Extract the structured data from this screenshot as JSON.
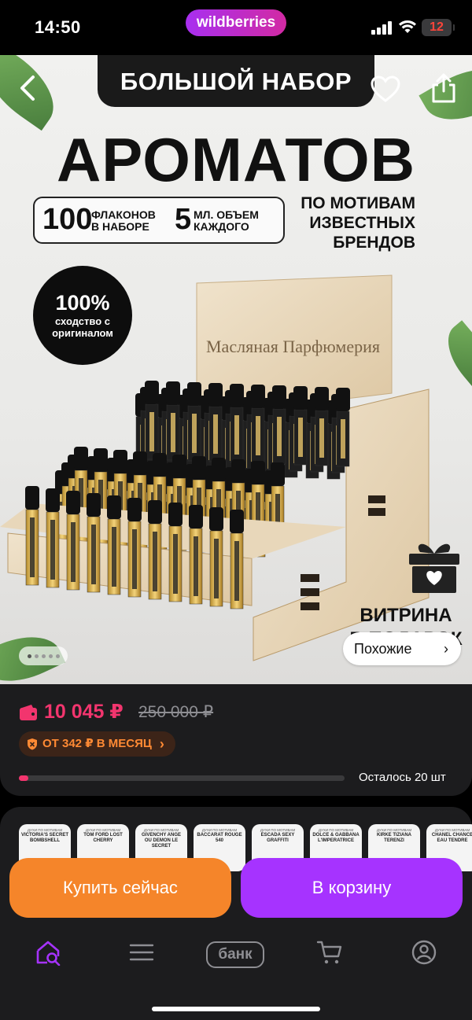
{
  "status_bar": {
    "time": "14:50",
    "brand": "wildberries",
    "battery": "12"
  },
  "product_image": {
    "banner": "БОЛЬШОЙ НАБОР",
    "title": "АРОМАТОВ",
    "bottles_count": "100",
    "bottles_label_1": "ФЛАКОНОВ",
    "bottles_label_2": "В НАБОРЕ",
    "volume": "5",
    "volume_label_1": "МЛ. ОБЪЕМ",
    "volume_label_2": "КАЖДОГО",
    "motives": [
      "ПО МОТИВАМ",
      "ИЗВЕСТНЫХ",
      "БРЕНДОВ"
    ],
    "similarity_pct": "100%",
    "similarity_text": [
      "сходство с",
      "оригиналом"
    ],
    "stand_sign": "Масляная Парфюмерия",
    "promo": [
      "ВИТРИНА",
      "В ПОДАРОК"
    ],
    "similar_label": "Похожие",
    "slide_count": 5,
    "active_slide": 0
  },
  "pricing": {
    "price": "10 045 ₽",
    "old_price": "250 000 ₽",
    "installment": "ОТ 342 ₽ В МЕСЯЦ",
    "stock_text": "Осталось 20 шт",
    "stock_fraction": 0.03,
    "accent_color": "#f2356e"
  },
  "variants": [
    {
      "line1": "ДУХИ ПО МОТИВАМ",
      "name": "VICTORIA'S SECRET BOMBSHELL"
    },
    {
      "line1": "ДУХИ ПО МОТИВАМ",
      "name": "TOM FORD LOST CHERRY"
    },
    {
      "line1": "ДУХИ ПО МОТИВАМ",
      "name": "GIVENCHY ANGE OU DEMON LE SECRET"
    },
    {
      "line1": "ДУХИ ПО МОТИВАМ",
      "name": "BACCARAT ROUGE 540"
    },
    {
      "line1": "ДУХИ ПО МОТИВАМ",
      "name": "ESCADA SEXY GRAFFITI"
    },
    {
      "line1": "ДУХИ ПО МОТИВАМ",
      "name": "DOLCE & GABBANA L'IMPERATRICE"
    },
    {
      "line1": "ДУХИ ПО МОТИВАМ",
      "name": "KIRKE TIZIANA TERENZI"
    },
    {
      "line1": "ДУХИ ПО МОТИВАМ",
      "name": "CHANEL CHANCE EAU TENDRE"
    }
  ],
  "actions": {
    "buy_now": "Купить сейчас",
    "to_cart": "В корзину"
  },
  "tabbar": {
    "bank_label": "банк",
    "items": [
      "home-search-icon",
      "menu-icon",
      "bank-icon",
      "cart-icon",
      "profile-icon"
    ],
    "active_color": "#a633ff"
  }
}
